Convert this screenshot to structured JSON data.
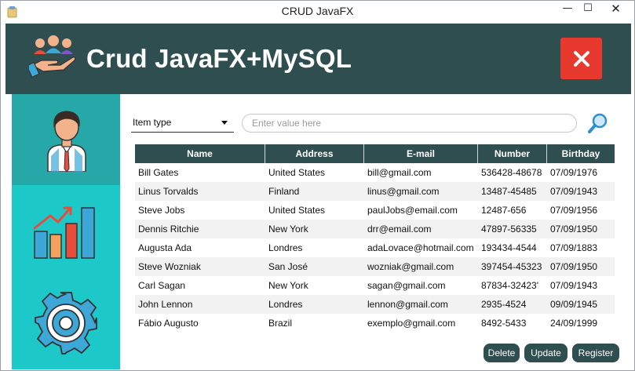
{
  "window": {
    "title": "CRUD JavaFX",
    "controls": {
      "minimize": "—",
      "maximize": "☐",
      "close": "✕"
    }
  },
  "header": {
    "title": "Crud JavaFX+MySQL",
    "logo_icon": "hand-people-icon",
    "close_icon": "close-icon",
    "accent": "#2f4e4f",
    "close_color": "#e8392f"
  },
  "sidebar": {
    "items": [
      {
        "icon": "user-icon",
        "selected": true
      },
      {
        "icon": "bar-chart-icon",
        "selected": false
      },
      {
        "icon": "gear-icon",
        "selected": false
      }
    ],
    "colors": {
      "selected": "#27a8a8",
      "normal": "#1dc8c8"
    }
  },
  "search": {
    "type_select": "Item type",
    "placeholder": "Enter value here",
    "button_icon": "magnifier-icon"
  },
  "table": {
    "columns": [
      "Name",
      "Address",
      "E-mail",
      "Number",
      "Birthday"
    ],
    "rows": [
      [
        "Bill Gates",
        "United States",
        "bill@gmail.com",
        "536428-48678",
        "07/09/1976"
      ],
      [
        "Linus Torvalds",
        "Finland",
        "linus@gmail.com",
        "13487-45485",
        "07/09/1943"
      ],
      [
        "Steve Jobs",
        "United States",
        "paulJobs@email.com",
        "12487-656",
        "07/09/1956"
      ],
      [
        "Dennis Ritchie",
        "New York",
        "drr@email.com",
        "47897-56335",
        "07/09/1950"
      ],
      [
        "Augusta Ada",
        "Londres",
        "adaLovace@hotmail.com",
        "193434-4544",
        "07/09/1883"
      ],
      [
        "Steve Wozniak",
        "San José",
        "wozniak@gmail.com",
        "397454-45323",
        "07/09/1950"
      ],
      [
        "Carl Sagan",
        "New York",
        "sagan@gmail.com",
        "87834-32423'",
        "07/09/1943"
      ],
      [
        "John Lennon",
        "Londres",
        "lennon@gmail.com",
        "2935-4524",
        "09/09/1945"
      ],
      [
        "Fábio Augusto",
        "Brazil",
        "exemplo@gmail.com",
        "8492-5433",
        "24/09/1999"
      ]
    ]
  },
  "actions": {
    "delete": "Delete",
    "update": "Update",
    "register": "Register"
  }
}
